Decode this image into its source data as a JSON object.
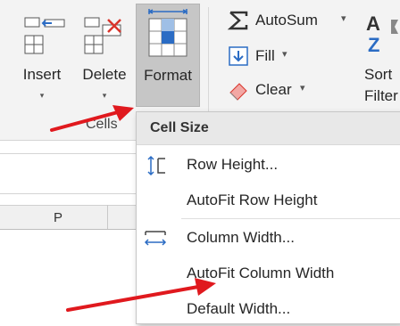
{
  "ribbon": {
    "cells_group": {
      "label": "Cells",
      "insert": {
        "label": "Insert",
        "caret": "▾"
      },
      "delete": {
        "label": "Delete",
        "caret": "▾"
      },
      "format": {
        "label": "Format"
      }
    },
    "editing": {
      "autosum": {
        "label": "AutoSum",
        "caret": "▾"
      },
      "fill": {
        "label": "Fill",
        "caret": "▾"
      },
      "clear": {
        "label": "Clear",
        "caret": "▾"
      }
    },
    "sort": {
      "line1": "Sort",
      "line2": "Filter"
    }
  },
  "sheet": {
    "column_header": "P"
  },
  "format_menu": {
    "section": "Cell Size",
    "items": [
      {
        "label": "Row Height..."
      },
      {
        "label": "AutoFit Row Height"
      },
      {
        "label": "Column Width..."
      },
      {
        "label": "AutoFit Column Width"
      },
      {
        "label": "Default Width..."
      }
    ]
  },
  "colors": {
    "annotation_arrow": "#e0191e",
    "format_button_active": "#c6c6c6",
    "icon_blue": "#2b6cc4",
    "icon_red": "#d9342b"
  }
}
